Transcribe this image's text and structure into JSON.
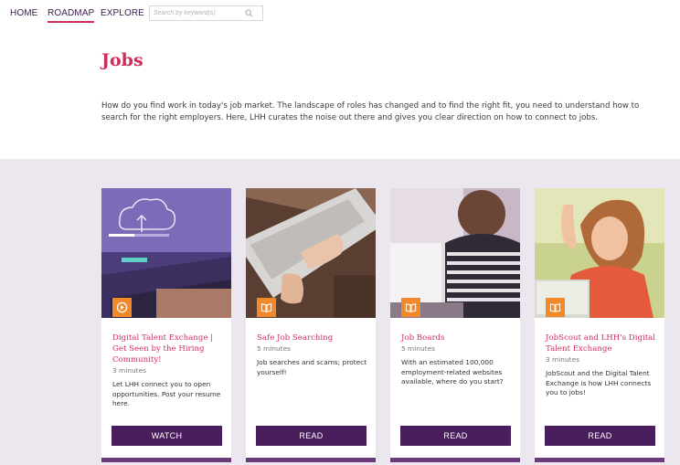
{
  "nav": {
    "home": "HOME",
    "roadmap": "ROADMAP",
    "explore": "EXPLORE",
    "search_placeholder": "Search by keyword(s)"
  },
  "page": {
    "title": "Jobs",
    "intro": "How do you find work in today's job market. The landscape of roles has changed and to find the right fit, you need to understand how to search for the right employers. Here, LHH curates the noise out there and gives you clear direction on how to connect to jobs."
  },
  "colors": {
    "accent": "#cf2e5b",
    "brand_purple": "#4a1d5c",
    "badge_orange": "#f28a2b",
    "section_bg": "#ece6ee"
  },
  "cards": [
    {
      "icon": "play-circle-icon",
      "title": "Digital Talent Exchange | Get Seen by the Hiring Community!",
      "duration": "3 minutes",
      "description": "Let LHH connect you to open opportunities. Post your resume here.",
      "action": "WATCH"
    },
    {
      "icon": "book-open-icon",
      "title": "Safe Job Searching",
      "duration": "5 minutes",
      "description": "Job searches and scams; protect yourself!",
      "action": "READ"
    },
    {
      "icon": "book-open-icon",
      "title": "Job Boards",
      "duration": "5 minutes",
      "description": "With an estimated 100,000 employment-related websites available, where do you start?",
      "action": "READ"
    },
    {
      "icon": "book-open-icon",
      "title": "JobScout and LHH's Digital Talent Exchange",
      "duration": "3 minutes",
      "description": "JobScout and the Digital Talent Exchange is how LHH connects you to jobs!",
      "action": "READ"
    }
  ]
}
